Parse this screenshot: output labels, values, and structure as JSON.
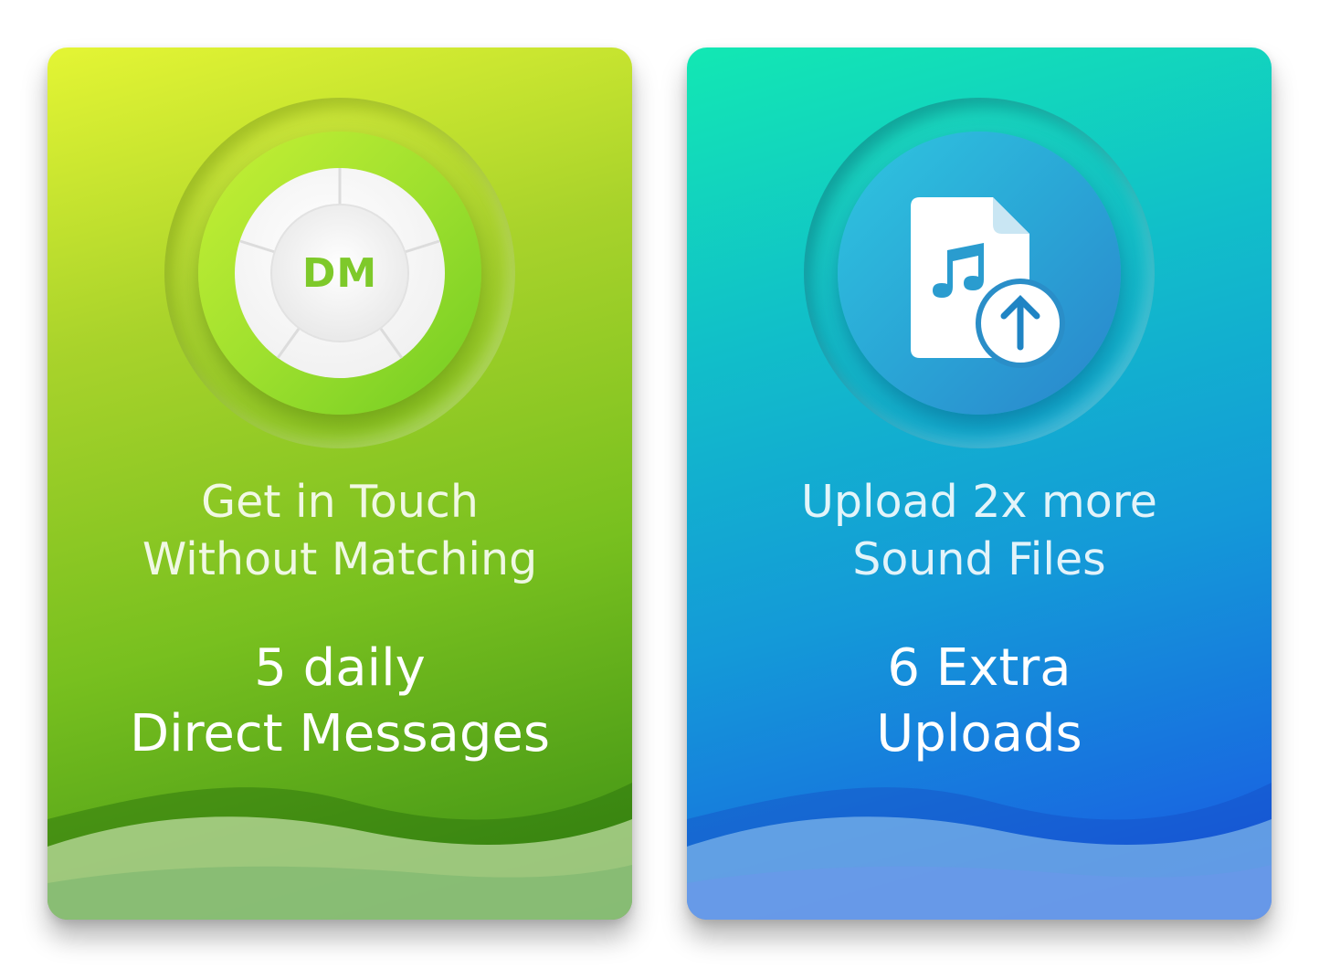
{
  "cards": [
    {
      "icon": "dm-badge-icon",
      "badge_text": "DM",
      "headline_line1": "Get in Touch",
      "headline_line2": "Without Matching",
      "value_line1": "5 daily",
      "value_line2": "Direct Messages",
      "accent": "#7ec92a"
    },
    {
      "icon": "music-file-upload-icon",
      "headline_line1": "Upload 2x more",
      "headline_line2": "Sound Files",
      "value_line1": "6 Extra",
      "value_line2": "Uploads",
      "accent": "#1499d8"
    }
  ]
}
